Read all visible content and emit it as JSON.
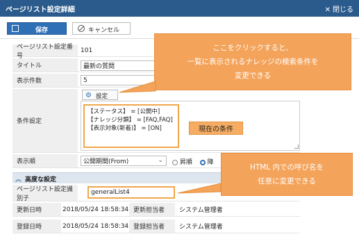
{
  "window": {
    "title": "ページリスト設定詳細",
    "close_label": "閉じる"
  },
  "toolbar": {
    "save_label": "保存",
    "cancel_label": "キャンセル"
  },
  "fields": {
    "page_no": {
      "label": "ページリスト設定番号",
      "value": "101"
    },
    "title": {
      "label": "タイトル",
      "value": "最新の質問"
    },
    "count": {
      "label": "表示件数",
      "value": "5"
    },
    "condition": {
      "label": "条件設定",
      "button_label": "設定",
      "lines": [
        "【ステータス】 = [公開中]",
        "【ナレッジ分類】 = [FAQ,FAQ]",
        "【表示対象(新着)】 = [ON]"
      ]
    },
    "order": {
      "label": "表示順",
      "select_value": "公開期間(From)",
      "radio_asc": "昇順",
      "radio_desc": "降"
    }
  },
  "advanced": {
    "section_label": "高度な設定",
    "identifier": {
      "label": "ページリスト設定識別子",
      "value": "generalList4"
    },
    "updated_at": {
      "label": "更新日時",
      "value": "2018/05/24 18:58:34"
    },
    "updated_by": {
      "label": "更新担当者",
      "value": "システム管理者"
    },
    "created_at": {
      "label": "登録日時",
      "value": "2018/05/24 18:58:34"
    },
    "created_by": {
      "label": "登録担当者",
      "value": "システム管理者"
    }
  },
  "annotations": {
    "callout_top": [
      "ここをクリックすると、",
      "一覧に表示されるナレッジの検索条件を",
      "変更できる"
    ],
    "current_condition": "現在の条件",
    "callout_bottom": [
      "HTML 内での呼び名を",
      "任意に変更できる"
    ]
  },
  "colors": {
    "titlebar": "#2b5b8c",
    "accent_orange": "#f4a35a",
    "save_button": "#2f6fb5"
  }
}
